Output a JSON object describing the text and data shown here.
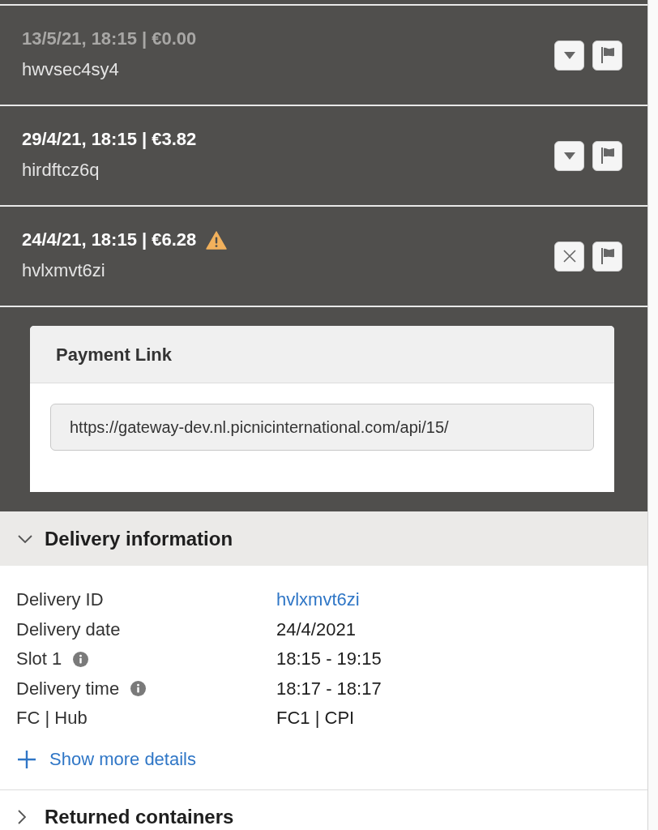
{
  "orders": [
    {
      "summary": "13/5/21, 18:15 | €0.00",
      "id": "hwvsec4sy4",
      "dimmed": true,
      "warning": false,
      "expanded": false
    },
    {
      "summary": "29/4/21, 18:15 | €3.82",
      "id": "hirdftcz6q",
      "dimmed": false,
      "warning": false,
      "expanded": false
    },
    {
      "summary": "24/4/21, 18:15 | €6.28",
      "id": "hvlxmvt6zi",
      "dimmed": false,
      "warning": true,
      "expanded": true,
      "payment_link": {
        "title": "Payment Link",
        "value": "https://gateway-dev.nl.picnicinternational.com/api/15/"
      }
    }
  ],
  "sections": [
    {
      "title": "Delivery information",
      "expanded": true,
      "fields": [
        {
          "label": "Delivery ID",
          "value": "hvlxmvt6zi",
          "kind": "link",
          "info": false
        },
        {
          "label": "Delivery date",
          "value": "24/4/2021",
          "kind": "text",
          "info": false
        },
        {
          "label": "Slot 1",
          "value": "18:15 - 19:15",
          "kind": "text",
          "info": true
        },
        {
          "label": "Delivery time",
          "value": "18:17 - 18:17",
          "kind": "text",
          "info": true
        },
        {
          "label": "FC | Hub",
          "value": "FC1 | CPI",
          "kind": "text",
          "info": false
        }
      ],
      "action": "Show more details"
    },
    {
      "title": "Returned containers",
      "expanded": false
    }
  ]
}
